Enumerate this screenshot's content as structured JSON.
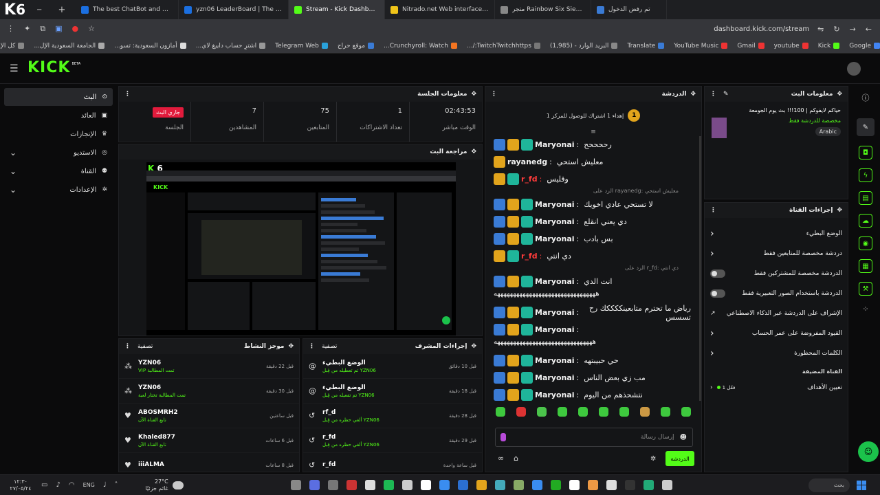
{
  "browser": {
    "tabs": [
      {
        "title": "The best ChatBot and Widgets",
        "color": "#1b6fe0"
      },
      {
        "title": "yzn06 LeaderBoard | The best C",
        "color": "#1b6fe0"
      },
      {
        "title": "Stream - Kick Dashboard",
        "color": "#53fc18",
        "active": true
      },
      {
        "title": "Nitrado.net Web interface - Da",
        "color": "#f0c419"
      },
      {
        "title": "متجر Rainbow Six Siege - ميلادك",
        "color": "#888888"
      },
      {
        "title": "تم رفض الدخول",
        "color": "#3a7bd5"
      }
    ],
    "url": "dashboard.kick.com/stream",
    "bookmarks": [
      "Google",
      "Kick",
      "youtube",
      "Gmail",
      "YouTube Music",
      "Translate",
      "البريد الوارد - (1,985)",
      "TwitchTwitchhttps:/...",
      "Crunchyroll: Watch...",
      "موقع حراج",
      "Telegram Web",
      "اشترِ حساب دايبغ لاي...",
      "أمازون السعودية: تسو...",
      "الجامعة السعودية الإل...",
      "كل الإشارات المرجعية"
    ]
  },
  "header": {
    "logo": "KICK",
    "beta": "BETA",
    "accent": "#53fc18"
  },
  "nav": [
    {
      "label": "البث",
      "icon": "broadcast-icon",
      "active": true
    },
    {
      "label": "العائد",
      "icon": "wallet-icon"
    },
    {
      "label": "الإنجازات",
      "icon": "trophy-icon"
    },
    {
      "label": "الاستديو",
      "icon": "studio-icon"
    },
    {
      "label": "القناة",
      "icon": "users-icon"
    },
    {
      "label": "الإعدادات",
      "icon": "gear-icon"
    }
  ],
  "session": {
    "title": "معلومات الجلسة",
    "live_badge": "جاري البث",
    "session_label": "الجلسة",
    "stats": [
      {
        "value": "7",
        "label": "المشاهدين"
      },
      {
        "value": "75",
        "label": "المتابعين"
      },
      {
        "value": "1",
        "label": "تعداد الاشتراكات"
      },
      {
        "value": "02:43:53",
        "label": "الوقت مباشر"
      }
    ]
  },
  "preview": {
    "title": "مراجعة البث"
  },
  "activity": {
    "title": "موجز النشاط",
    "filter": "تصفية",
    "items": [
      {
        "name": "YZN06",
        "sub": "VIP تمت المطالبة",
        "time": "قبل 22 دقيقة",
        "icon": "reward-icon"
      },
      {
        "name": "YZN06",
        "sub": "تمت المطالبة تختار لعبة",
        "time": "قبل 30 دقيقة",
        "icon": "reward-icon"
      },
      {
        "name": "ABOSMRH2",
        "sub": "تابع القناة الآن",
        "time": "قبل ساعتين",
        "icon": "heart-icon"
      },
      {
        "name": "Khaled877",
        "sub": "تابع القناة الآن",
        "time": "قبل 6 ساعات",
        "icon": "heart-icon"
      },
      {
        "name": "iiiALMA",
        "sub": "",
        "time": "قبل 8 ساعات",
        "icon": "heart-icon"
      }
    ]
  },
  "modactions": {
    "title": "إجراءات المشرف",
    "filter": "تصفية",
    "items": [
      {
        "name": "الوضع البطيء",
        "sub": "تم تعطيله من قِبل YZN06",
        "time": "قبل 10 دقائق"
      },
      {
        "name": "الوضع البطيء",
        "sub": "تم تفعيله من قِبل YZN06",
        "time": "قبل 18 دقيقة"
      },
      {
        "name": "rf_d",
        "sub": "ألغي حظره من قِبل YZN06",
        "time": "قبل 28 دقيقة"
      },
      {
        "name": "r_fd",
        "sub": "ألغي حظره من قِبل YZN06",
        "time": "قبل 29 دقيقة"
      },
      {
        "name": "r_fd",
        "sub": "",
        "time": "قبل ساعة واحدة"
      }
    ]
  },
  "chat": {
    "title": "الدردشة",
    "pinned": "إهداء 1 اشتراك للوصول للمركز 1",
    "placeholder": "إرسال رسالة",
    "send": "الدردشة",
    "messages": [
      {
        "user": "Maryonai",
        "color": "#f2f2f2",
        "text": "رححححح",
        "badges": [
          "mod",
          "crown",
          "sub"
        ]
      },
      {
        "user": "rayanedg",
        "color": "#f2f2f2",
        "text": "معليش استحي",
        "badges": [
          "crown"
        ]
      },
      {
        "user": "r_fd",
        "color": "#ff3b3b",
        "text": "وقليس",
        "badges": [
          "crown",
          "sub"
        ]
      },
      {
        "reply": "الرد على rayanedg: معليش استحي"
      },
      {
        "user": "Maryonai",
        "color": "#f2f2f2",
        "text": "لا تستحي عادي اخويك",
        "badges": [
          "mod",
          "crown",
          "sub"
        ]
      },
      {
        "user": "Maryonai",
        "color": "#f2f2f2",
        "text": "دي يعني انقلع",
        "badges": [
          "mod",
          "crown",
          "sub"
        ]
      },
      {
        "user": "Maryonai",
        "color": "#f2f2f2",
        "text": "بس بادب",
        "badges": [
          "mod",
          "crown",
          "sub"
        ]
      },
      {
        "user": "r_fd",
        "color": "#ff3b3b",
        "text": "دي انتي",
        "badges": [
          "crown",
          "sub"
        ]
      },
      {
        "reply": "الرد على r_fd: دي انتي"
      },
      {
        "user": "Maryonai",
        "color": "#f2f2f2",
        "text": "انت الدي",
        "badges": [
          "mod",
          "crown",
          "sub"
        ]
      },
      {
        "cont": "ههههههههههههههههههههههههههههههههه"
      },
      {
        "user": "Maryonai",
        "color": "#f2f2f2",
        "text": "رياض ما تحترم متابعينككككك رح تسسس",
        "badges": [
          "mod",
          "crown",
          "sub"
        ]
      },
      {
        "user": "Maryonai",
        "color": "#f2f2f2",
        "text": "",
        "badges": [
          "mod",
          "crown",
          "sub"
        ]
      },
      {
        "cont": "هههههههههههههههههههههههههههههههه"
      },
      {
        "user": "Maryonai",
        "color": "#f2f2f2",
        "text": "حي حبيبتهه",
        "badges": [
          "mod",
          "crown",
          "sub"
        ]
      },
      {
        "user": "Maryonai",
        "color": "#f2f2f2",
        "text": "مب زي بعض الناس",
        "badges": [
          "mod",
          "crown",
          "sub"
        ]
      },
      {
        "user": "Maryonai",
        "color": "#f2f2f2",
        "text": "نتشحذهم من اليوم",
        "badges": [
          "mod",
          "crown",
          "sub"
        ]
      }
    ]
  },
  "streaminfo": {
    "title": "معلومات البث",
    "stream_title": "حياكم لايفوكم | 100!!! بث يوم الجومعة",
    "category": "مخصصة للدردشة فقط",
    "tag": "Arabic"
  },
  "channelactions": {
    "title": "إجراءات القناة",
    "rows": [
      {
        "label": "الوضع البطيء",
        "kind": "chevron"
      },
      {
        "label": "دردشة مخصصة للمتابعين فقط",
        "kind": "chevron"
      },
      {
        "label": "الدردشة مخصصة للمشتركين فقط",
        "kind": "toggle"
      },
      {
        "label": "الدردشة باستخدام الصور التعبيرية فقط",
        "kind": "toggle"
      },
      {
        "label": "الإشراف على الدردشة عبر الذكاء الاصطناعي",
        "kind": "external"
      },
      {
        "label": "القيود المفروضة على عمر الحساب",
        "kind": "chevron"
      },
      {
        "label": "الكلمات المحظورة",
        "kind": "chevron"
      }
    ],
    "section": "القناة المضيفة",
    "goals_label": "تعيين الأهداف",
    "goals_value": "فعّل 1"
  },
  "taskbar": {
    "search": "بحث",
    "lang": "ENG",
    "weather_temp": "27°C",
    "weather_text": "غائم جزئيًا",
    "time": "١٢:٣٠",
    "date": "٢٧/٠٥/٢٤"
  }
}
